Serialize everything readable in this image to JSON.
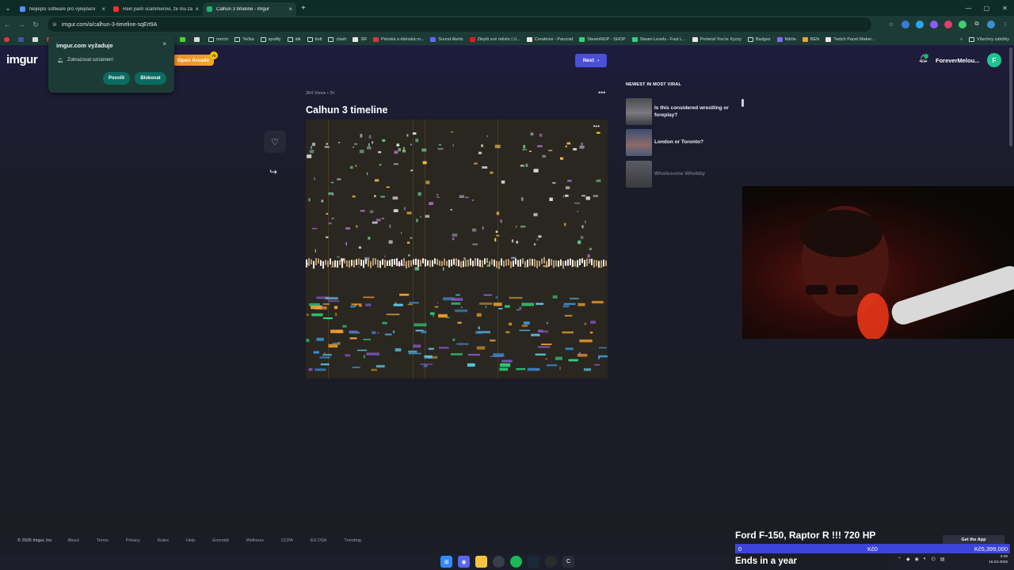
{
  "browser": {
    "tabs": [
      {
        "title": "Nejlepší software pro vylepšení",
        "color": "#5b8cff"
      },
      {
        "title": "Řekl jsem scammerovi, že mu za",
        "color": "#ff2d2d"
      },
      {
        "title": "Calhun 3 timeline - Imgur",
        "color": "#1bb76e",
        "active": true
      }
    ],
    "new_tab": "+",
    "address": "imgur.com/a/calhun-3-timeline-sqErt9A",
    "bookmarks": [
      {
        "label": "merch",
        "folder": true
      },
      {
        "label": "Tečka",
        "folder": true
      },
      {
        "label": "spotify",
        "folder": true
      },
      {
        "label": "idk",
        "folder": true
      },
      {
        "label": "bolt",
        "folder": true
      },
      {
        "label": "clash",
        "folder": true
      },
      {
        "label": "SR",
        "folder": false,
        "color": "#e8e8e8"
      },
      {
        "label": "Pánská a dámská m...",
        "folder": false,
        "color": "#d93636"
      },
      {
        "label": "Sound Alerts",
        "folder": false,
        "color": "#6c63ff"
      },
      {
        "label": "Zlepši své město | U...",
        "folder": false,
        "color": "#d81f1f"
      },
      {
        "label": "Creations - Panzoid",
        "folder": false,
        "color": "#e8e8e8"
      },
      {
        "label": "SteamMUP - SHOP",
        "folder": false,
        "color": "#2dd47a"
      },
      {
        "label": "Steam.Levels - Fast L...",
        "folder": false,
        "color": "#2dd47a"
      },
      {
        "label": "Pretend You're Xyzzy",
        "folder": false,
        "color": "#e8e8e8"
      },
      {
        "label": "Badges",
        "folder": true
      },
      {
        "label": "Nitrite",
        "folder": false,
        "color": "#7c6bff"
      },
      {
        "label": "BEN",
        "folder": false,
        "color": "#f0a030"
      },
      {
        "label": "Twitch Panel Maker...",
        "folder": false,
        "color": "#e8e8e8"
      }
    ],
    "bookmarks_more": "»",
    "all_bookmarks": "Všechny záložky"
  },
  "notification": {
    "title": "imgur.com vyžaduje",
    "message": "Zobrazovat oznámení",
    "allow": "Povolit",
    "block": "Blokovat",
    "close": "×"
  },
  "header": {
    "logo": "imgur",
    "arcade": "Open Arcade",
    "arcade_badge": "7h",
    "next": "Next",
    "username": "ForeverMelou...",
    "avatar_letter": "F"
  },
  "post": {
    "meta": "364 Views • 2h",
    "title": "Calhun 3 timeline",
    "menu": "•••",
    "image_menu": "•••"
  },
  "sidebar": {
    "heading": "NEWEST IN MOST VIRAL",
    "items": [
      {
        "title": "Is this considered wrestling or foreplay?",
        "thumb": "#6a6a70"
      },
      {
        "title": "London or Toronto?",
        "thumb": "#5a6a8a"
      },
      {
        "title": "Wholesome Whobby",
        "thumb": "#8a8a88"
      }
    ]
  },
  "footer": {
    "copyright": "© 2026 Imgur, Inc",
    "links": [
      "About",
      "Terms",
      "Privacy",
      "Rules",
      "Help",
      "Emerald",
      "Wellness",
      "CCPA",
      "EU DSA",
      "Trending"
    ],
    "get_app": "Get the App"
  },
  "overlay": {
    "title": "Ford F-150, Raptor R !!! 720 HP",
    "left": "0",
    "mid": "Kč0",
    "right": "Kč5,399,000",
    "sub": "Ends in a year"
  },
  "taskbar": {
    "time": "3:36",
    "date": "16.03.2026"
  }
}
